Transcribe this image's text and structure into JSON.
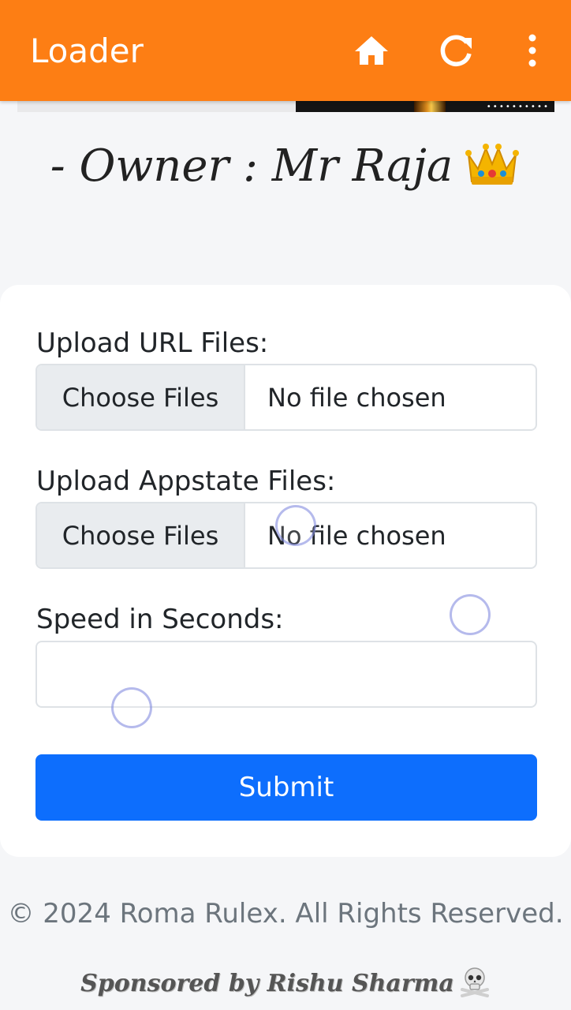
{
  "appbar": {
    "title": "Loader",
    "color": "#fd7e14",
    "actions": [
      {
        "icon": "home-icon"
      },
      {
        "icon": "refresh-icon"
      },
      {
        "icon": "more-vertical-icon"
      }
    ]
  },
  "header": {
    "owner_text": "- Owner : Mr Raja",
    "emoji": "crown-icon"
  },
  "form": {
    "url_files": {
      "label": "Upload URL Files:",
      "button_label": "Choose Files",
      "status": "No file chosen"
    },
    "appstate_files": {
      "label": "Upload Appstate Files:",
      "button_label": "Choose Files",
      "status": "No file chosen"
    },
    "speed": {
      "label": "Speed in Seconds:",
      "value": "",
      "placeholder": ""
    },
    "submit_label": "Submit",
    "submit_color": "#0d6efd"
  },
  "footer": {
    "copyright": "© 2024 Roma Rulex. All Rights Reserved.",
    "sponsor": "Sponsored by Rishu Sharma",
    "sponsor_emoji": "skull-crossbones-icon"
  }
}
